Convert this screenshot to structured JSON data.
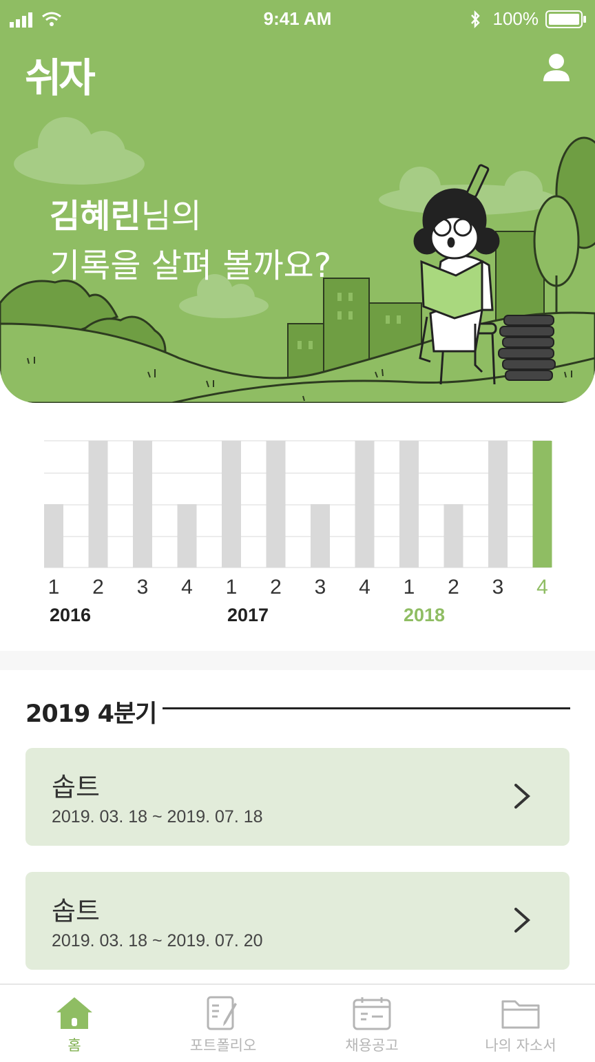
{
  "status_bar": {
    "time": "9:41 AM",
    "battery": "100%"
  },
  "header": {
    "logo": "쉬자"
  },
  "greeting": {
    "name": "김혜린",
    "suffix": "님의",
    "line2": "기록을 살펴 볼까요?"
  },
  "colors": {
    "brand": "#8fbd63",
    "bar_inactive": "#d9d9d9",
    "bar_active": "#8fbd63",
    "card_bg": "#e2ecda"
  },
  "chart_data": {
    "type": "bar",
    "categories": [
      "1",
      "2",
      "3",
      "4",
      "1",
      "2",
      "3",
      "4",
      "1",
      "2",
      "3",
      "4"
    ],
    "year_labels": [
      "2016",
      "2017",
      "2018"
    ],
    "values": [
      2,
      4,
      4,
      2,
      4,
      4,
      2,
      4,
      4,
      2,
      4,
      4
    ],
    "highlight_index": 11,
    "ylim": [
      0,
      4
    ]
  },
  "section": {
    "title": "2019 4분기"
  },
  "cards": [
    {
      "name": "솝트",
      "date": "2019. 03. 18  ~ 2019. 07. 18"
    },
    {
      "name": "솝트",
      "date": "2019. 03. 18  ~ 2019. 07. 20"
    }
  ],
  "tabs": [
    {
      "label": "홈",
      "icon": "home-icon"
    },
    {
      "label": "포트폴리오",
      "icon": "portfolio-icon"
    },
    {
      "label": "채용공고",
      "icon": "calendar-icon"
    },
    {
      "label": "나의 자소서",
      "icon": "folder-icon"
    }
  ]
}
